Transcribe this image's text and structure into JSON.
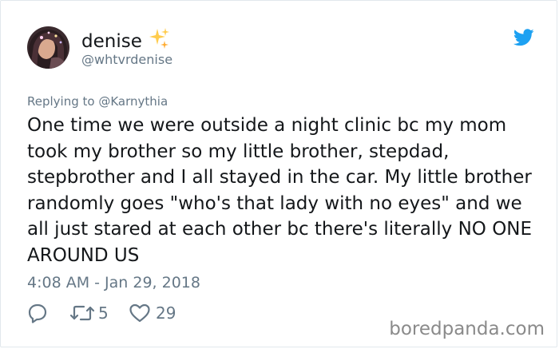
{
  "tweet": {
    "display_name": "denise",
    "handle": "@whtvrdenise",
    "replying_to": "Replying to @Karnythia",
    "text": "One time we were outside a night clinic bc my mom took my brother so my little brother, stepdad, stepbrother and I all stayed in the car. My little brother randomly goes \"who's that lady with no eyes\" and we all just stared at each other bc there's literally NO ONE AROUND US",
    "timestamp": "4:08 AM - Jan 29, 2018",
    "retweet_count": "5",
    "like_count": "29"
  },
  "watermark": "boredpanda.com",
  "colors": {
    "twitter_blue": "#1da1f2",
    "secondary_text": "#657786",
    "primary_text": "#14171a",
    "sparkle_yellow": "#ffcc4d"
  },
  "icons": {
    "brand": "twitter-bird-icon",
    "name_emoji": "sparkles-icon",
    "reply": "reply-bubble-icon",
    "retweet": "retweet-icon",
    "like": "heart-icon"
  }
}
